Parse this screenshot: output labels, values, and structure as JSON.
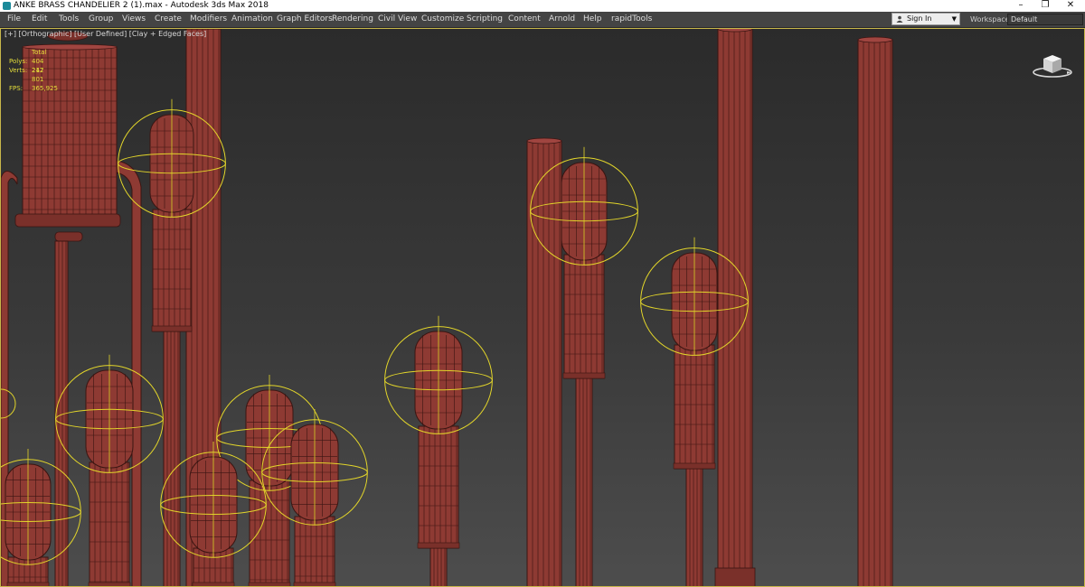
{
  "window": {
    "title": "ANKE BRASS CHANDELIER 2 (1).max - Autodesk 3ds Max 2018",
    "controls": [
      "–",
      "❐",
      "✕"
    ]
  },
  "menubar": {
    "items": [
      "File",
      "Edit",
      "Tools",
      "Group",
      "Views",
      "Create",
      "Modifiers",
      "Animation",
      "Graph Editors",
      "Rendering",
      "Civil View",
      "Customize",
      "Scripting",
      "Content",
      "Arnold",
      "Help",
      "rapidTools"
    ],
    "signin_label": "Sign In",
    "workspaces_label": "Workspaces:",
    "workspace_value": "Default"
  },
  "viewport": {
    "label": "[+] [Orthographic] [User Defined] [Clay + Edged Faces]",
    "stats": {
      "header": "Total",
      "polys_label": "Polys:",
      "polys_value": "404 212",
      "verts_label": "Verts:",
      "verts_value": "247 801",
      "fps_label": "FPS:",
      "fps_value": "365,925"
    }
  },
  "colors": {
    "clay": "#8e3a33",
    "edge": "#3a1512",
    "selection": "#e2d52a",
    "viewport_border": "#c8b74a"
  },
  "icons": [
    "app-icon",
    "user-icon",
    "viewcube-icon"
  ]
}
